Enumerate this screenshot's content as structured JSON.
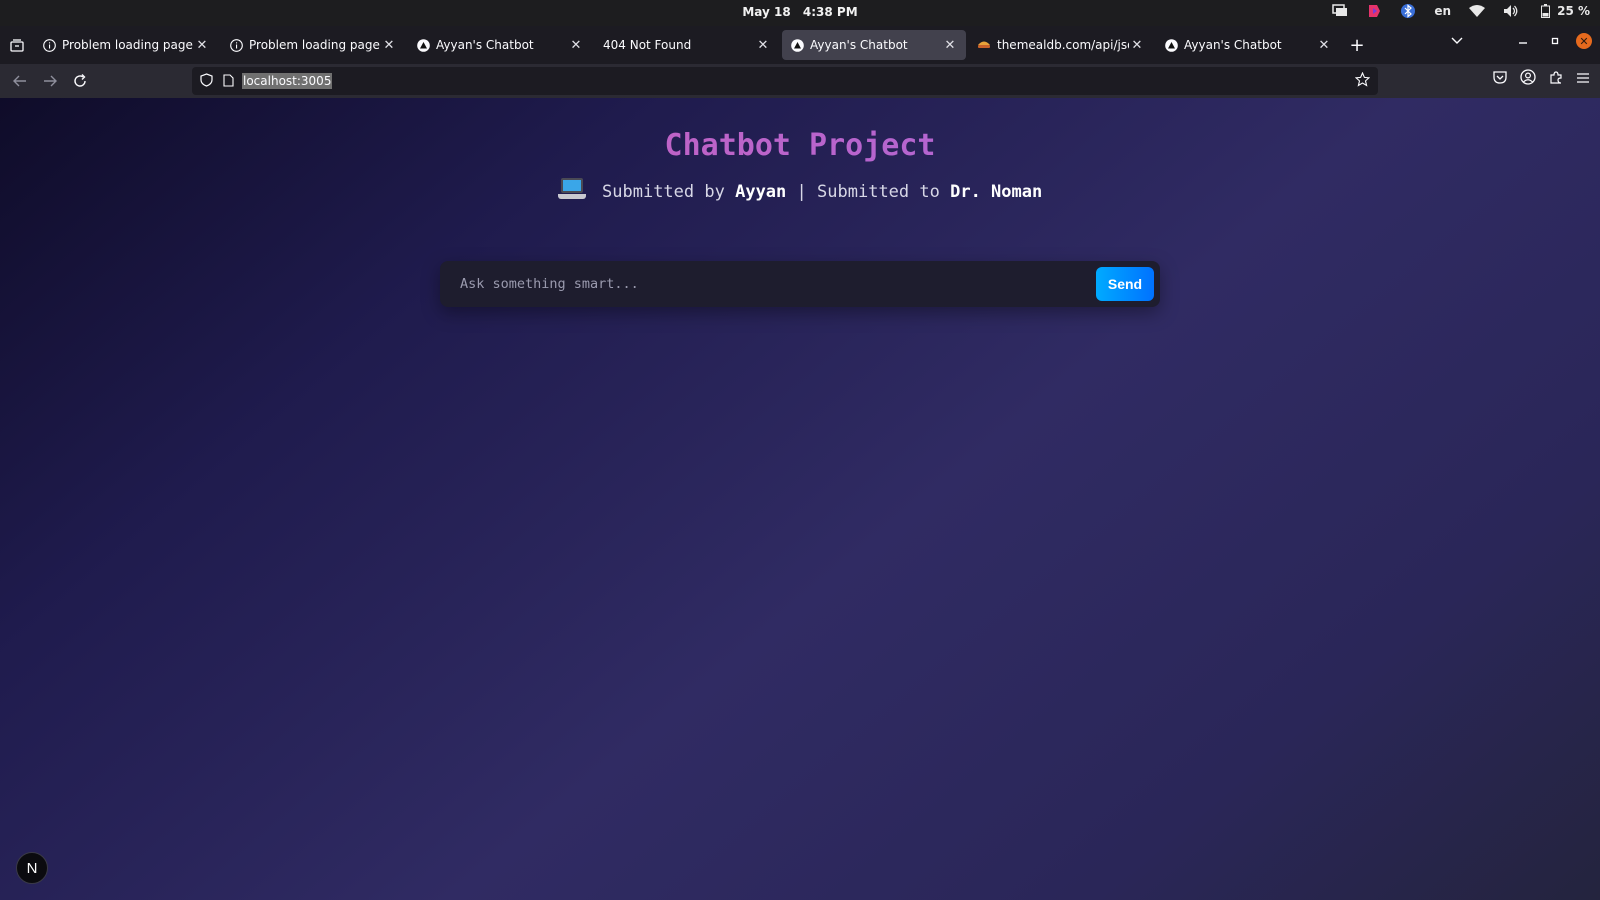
{
  "system": {
    "date": "May 18",
    "time": "4:38 PM",
    "language": "en",
    "battery": "25 %"
  },
  "tabs": [
    {
      "label": "Problem loading page",
      "icon": "info-icon",
      "active": false
    },
    {
      "label": "Problem loading page",
      "icon": "info-icon",
      "active": false
    },
    {
      "label": "Ayyan's Chatbot",
      "icon": "triangle-logo-icon",
      "active": false
    },
    {
      "label": "404 Not Found",
      "icon": "",
      "active": false
    },
    {
      "label": "Ayyan's Chatbot",
      "icon": "triangle-logo-icon",
      "active": true
    },
    {
      "label": "themealdb.com/api/json/v",
      "icon": "food-icon",
      "active": false
    },
    {
      "label": "Ayyan's Chatbot",
      "icon": "triangle-logo-icon",
      "active": false
    }
  ],
  "address": {
    "url": "localhost:3005"
  },
  "page": {
    "title": "Chatbot Project",
    "submitted_by_label": "Submitted by",
    "author": "Ayyan",
    "separator": "|",
    "submitted_to_label": "Submitted to",
    "advisor": "Dr. Noman",
    "input_placeholder": "Ask something smart...",
    "send_label": "Send",
    "badge_letter": "N"
  },
  "colors": {
    "title_gradient_start": "#d65db1",
    "title_gradient_end": "#9d6be6",
    "send_button": "#0090ff",
    "page_background": "#302b63"
  }
}
